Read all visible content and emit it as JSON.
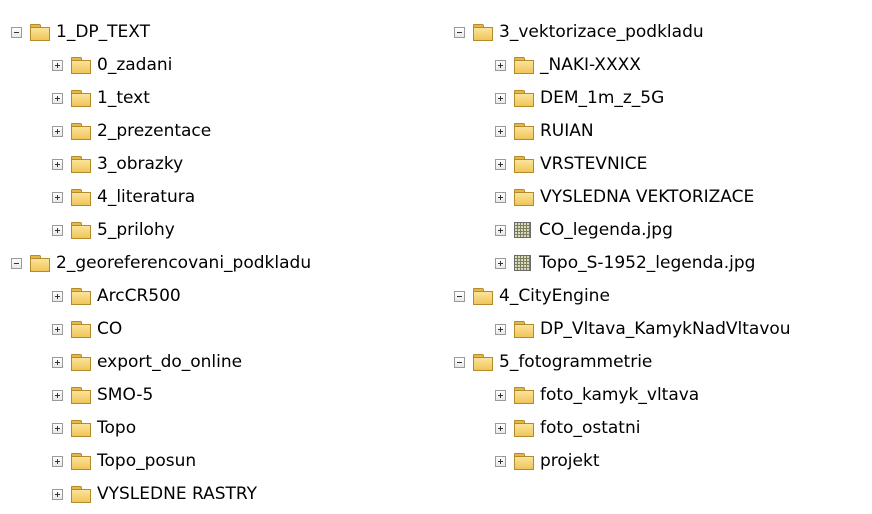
{
  "left_tree": {
    "groups": [
      {
        "label": "1_DP_TEXT",
        "children": [
          "0_zadani",
          "1_text",
          "2_prezentace",
          "3_obrazky",
          "4_literatura",
          "5_prilohy"
        ]
      },
      {
        "label": "2_georeferencovani_podkladu",
        "children": [
          "ArcCR500",
          "CO",
          "export_do_online",
          "SMO-5",
          "Topo",
          "Topo_posun",
          "VYSLEDNE RASTRY"
        ]
      }
    ]
  },
  "right_tree": {
    "groups": [
      {
        "label": "3_vektorizace_podkladu",
        "children": [
          "_NAKI-XXXX",
          "DEM_1m_z_5G",
          "RUIAN",
          "VRSTEVNICE",
          "VYSLEDNA VEKTORIZACE",
          "CO_legenda.jpg",
          "Topo_S-1952_legenda.jpg"
        ]
      },
      {
        "label": "4_CityEngine",
        "children": [
          "DP_Vltava_KamykNadVltavou"
        ]
      },
      {
        "label": "5_fotogrammetrie",
        "children": [
          "foto_kamyk_vltava",
          "foto_ostatni",
          "projekt"
        ]
      }
    ]
  },
  "icons": {
    "folder": "folder-icon",
    "image_file": "image-file-icon",
    "expand": "expand-plus-icon",
    "collapse": "collapse-minus-icon"
  }
}
